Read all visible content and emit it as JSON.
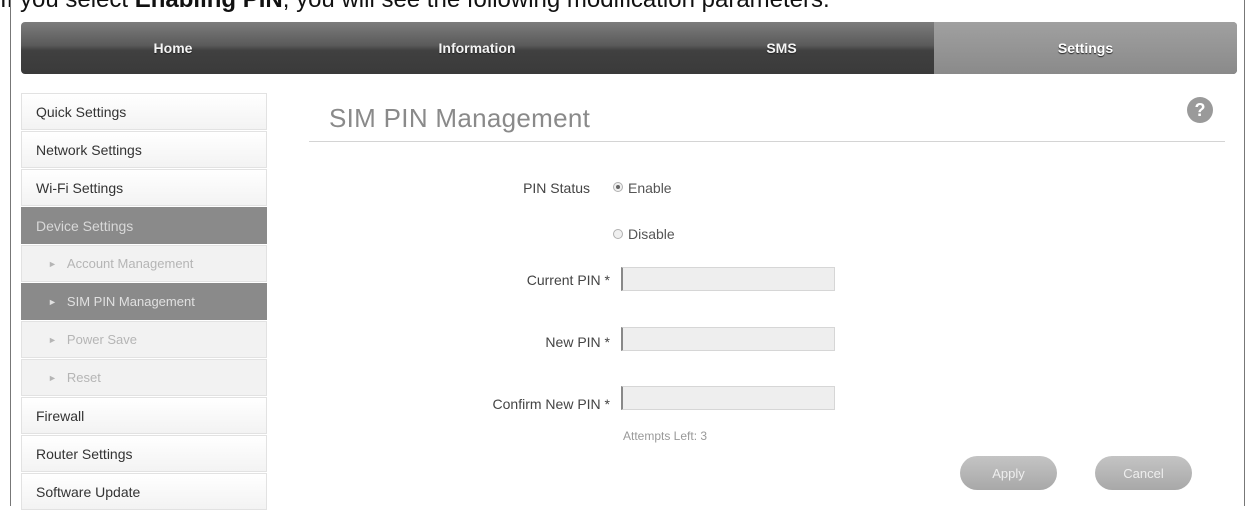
{
  "caption": {
    "prefix": "If you select ",
    "bold": "Enabling PIN",
    "suffix": ", you will see the following modification parameters."
  },
  "nav": {
    "tabs": [
      {
        "label": "Home"
      },
      {
        "label": "Information"
      },
      {
        "label": "SMS"
      },
      {
        "label": "Settings"
      }
    ],
    "active": "Settings"
  },
  "sidebar": {
    "items": [
      {
        "label": "Quick Settings"
      },
      {
        "label": "Network Settings"
      },
      {
        "label": "Wi-Fi Settings"
      },
      {
        "label": "Device Settings"
      },
      {
        "label": "Account Management"
      },
      {
        "label": "SIM PIN Management"
      },
      {
        "label": "Power Save"
      },
      {
        "label": "Reset"
      },
      {
        "label": "Firewall"
      },
      {
        "label": "Router Settings"
      },
      {
        "label": "Software Update"
      }
    ]
  },
  "main": {
    "title": "SIM PIN Management",
    "help": "?",
    "pin_status_label": "PIN Status",
    "enable_label": "Enable",
    "disable_label": "Disable",
    "current_pin_label": "Current PIN *",
    "new_pin_label": "New PIN *",
    "confirm_pin_label": "Confirm New PIN *",
    "current_pin_value": "",
    "new_pin_value": "",
    "confirm_pin_value": "",
    "attempts_left": "Attempts Left: 3",
    "apply_label": "Apply",
    "cancel_label": "Cancel",
    "selected_status": "Enable"
  },
  "colors": {
    "nav_dark": "#3a3a3a",
    "nav_active": "#8a8a8a",
    "sidebar_active": "#8a8a8a"
  }
}
